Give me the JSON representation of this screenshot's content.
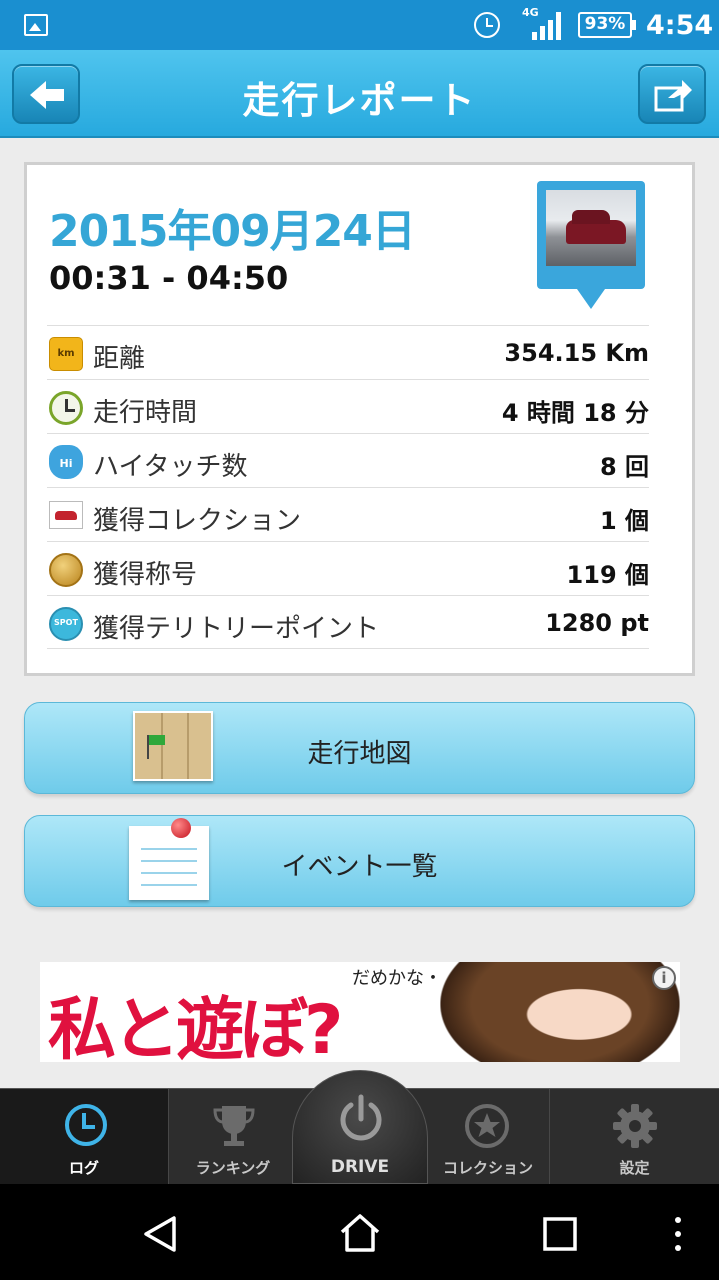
{
  "status_bar": {
    "network": "4G",
    "battery": "93%",
    "time": "4:54"
  },
  "header": {
    "title": "走行レポート"
  },
  "report": {
    "date": "2015年09月24日",
    "time_range": "00:31 - 04:50",
    "rows": [
      {
        "icon": "km-icon",
        "icon_text": "km",
        "label": "距離",
        "value": "354.15 Km"
      },
      {
        "icon": "clock-icon",
        "icon_text": "",
        "label": "走行時間",
        "value": "4 時間 18 分"
      },
      {
        "icon": "high-five-icon",
        "icon_text": "Hi",
        "label": "ハイタッチ数",
        "value": "8 回"
      },
      {
        "icon": "car-icon",
        "icon_text": "",
        "label": "獲得コレクション",
        "value": "1 個"
      },
      {
        "icon": "medal-icon",
        "icon_text": "",
        "label": "獲得称号",
        "value": "119 個"
      },
      {
        "icon": "spot-icon",
        "icon_text": "SPOT",
        "label": "獲得テリトリーポイント",
        "value": "1280 pt"
      }
    ]
  },
  "actions": {
    "map_label": "走行地図",
    "events_label": "イベント一覧"
  },
  "ad": {
    "headline": "私と遊ぼ?",
    "subtext": "だめかな・・・?",
    "info": "i"
  },
  "tabs": {
    "log": "ログ",
    "ranking": "ランキング",
    "drive": "DRIVE",
    "collection": "コレクション",
    "settings": "設定"
  },
  "colors": {
    "accent": "#27a9de",
    "date_text": "#35a6d6",
    "status_bar": "#1a8fd0",
    "ad_text": "#e0113f"
  }
}
